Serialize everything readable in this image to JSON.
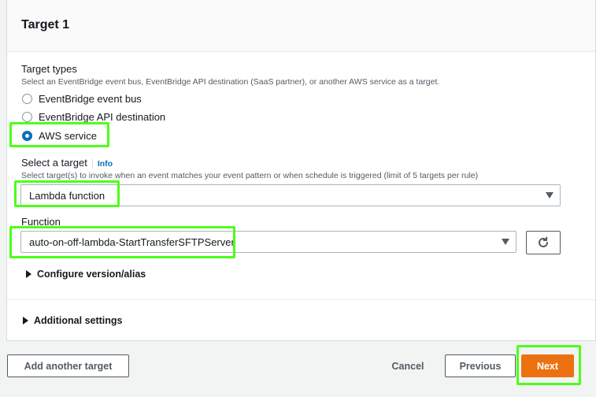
{
  "panel": {
    "title": "Target 1"
  },
  "target_types": {
    "label": "Target types",
    "description": "Select an EventBridge event bus, EventBridge API destination (SaaS partner), or another AWS service as a target.",
    "options": [
      {
        "label": "EventBridge event bus",
        "selected": false
      },
      {
        "label": "EventBridge API destination",
        "selected": false
      },
      {
        "label": "AWS service",
        "selected": true
      }
    ]
  },
  "select_target": {
    "label": "Select a target",
    "info": "Info",
    "description": "Select target(s) to invoke when an event matches your event pattern or when schedule is triggered (limit of 5 targets per rule)",
    "value": "Lambda function"
  },
  "function": {
    "label": "Function",
    "value": "auto-on-off-lambda-StartTransferSFTPServer"
  },
  "configure_version": {
    "label": "Configure version/alias"
  },
  "additional_settings": {
    "label": "Additional settings"
  },
  "footer": {
    "add_target": "Add another target",
    "cancel": "Cancel",
    "previous": "Previous",
    "next": "Next"
  },
  "colors": {
    "highlight": "#4cff1a",
    "primary": "#ec7211",
    "link": "#0073bb"
  },
  "icons": {
    "refresh": "refresh-icon",
    "dropdown": "caret-down-icon",
    "expand": "caret-right-icon"
  }
}
